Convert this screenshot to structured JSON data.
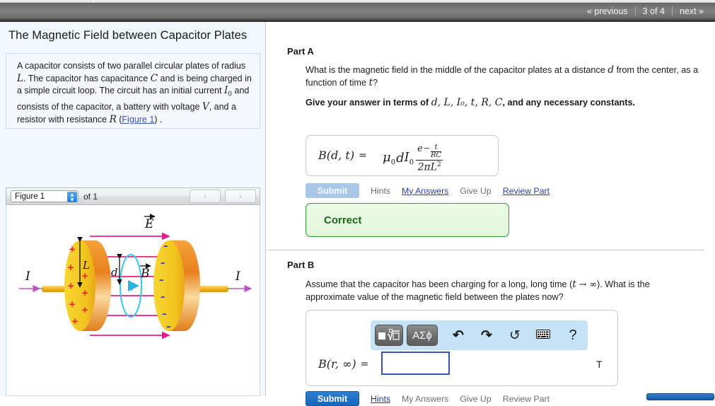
{
  "topbar": {
    "previous_label": "« previous",
    "page_indicator": "3 of 4",
    "next_label": "next »"
  },
  "left_panel": {
    "title": "The Magnetic Field between Capacitor Plates",
    "problem_text_parts": {
      "p1": "A capacitor consists of two parallel circular plates of radius ",
      "v_L": "L",
      "p2": ". The capacitor has capacitance ",
      "v_C": "C",
      "p3": " and is being charged in a simple circuit loop. The circuit has an initial current ",
      "v_I0": "I",
      "v_I0sub": "0",
      "p4": " and consists of the capacitor, a battery with voltage ",
      "v_V": "V",
      "p5": ", and a resistor with resistance ",
      "v_R": "R",
      "p6_open": " (",
      "figure_link": "Figure 1",
      "p6_close": ") ."
    },
    "figure_bar": {
      "select_value": "Figure 1",
      "of_label": "of 1",
      "prev_arrow": "‹",
      "next_arrow": "›"
    },
    "figure": {
      "label_E": "E",
      "label_B": "B",
      "label_L": "L",
      "label_d": "d",
      "label_I_left": "I",
      "label_I_right": "I",
      "plus_sign": "+",
      "minus_sign": "–",
      "colors": {
        "plate_face": "#f5cc2a",
        "plate_rim": "#e8821e",
        "field_line": "#ec1a8d",
        "b_loop": "#37c6ef",
        "wire": "#f0b21e",
        "plus": "#e8191c",
        "minus": "#1b3fa0"
      }
    }
  },
  "part_a": {
    "label": "Part A",
    "question_line1_a": "What is the magnetic field in the middle of the capacitor plates at a distance ",
    "question_var_d": "d",
    "question_line1_b": " from the center, as a function of time ",
    "question_var_t": "t",
    "question_line1_c": "?",
    "instruction_prefix": "Give your answer in terms of ",
    "instruction_vars": "d, L, I₀, t, R, C",
    "instruction_suffix": ", and any necessary constants.",
    "answer": {
      "lhs": "B(d, t)",
      "equals": "=",
      "mu": "μ",
      "mu_sub": "0",
      "d": "d",
      "I": "I",
      "I_sub": "0",
      "num_e": "e",
      "num_minus": "−",
      "exp_num": "t",
      "exp_den": "RC",
      "denominator": "2πL",
      "denominator_exp": "2"
    },
    "actions": {
      "submit": "Submit",
      "hints": "Hints",
      "my_answers": "My Answers",
      "give_up": "Give Up",
      "review_part": "Review Part"
    },
    "feedback": "Correct"
  },
  "part_b": {
    "label": "Part B",
    "question_a": "Assume that the capacitor has been charging for a long, long time (",
    "question_var_t": "t",
    "question_arrow": " → ∞",
    "question_b": "). What is the approximate value of the magnetic field between the plates now?",
    "math_toolbar": {
      "template_button": "template-math-icon",
      "symbols_button": "ΑΣϕ",
      "undo": "↶",
      "redo": "↷",
      "reset": "↺",
      "keyboard": "keyboard-icon",
      "help": "?"
    },
    "answer": {
      "lhs": "B(r, ∞)",
      "equals": "=",
      "input_value": "",
      "unit": "T"
    },
    "actions": {
      "submit": "Submit",
      "hints": "Hints",
      "my_answers": "My Answers",
      "give_up": "Give Up",
      "review_part": "Review Part"
    }
  }
}
